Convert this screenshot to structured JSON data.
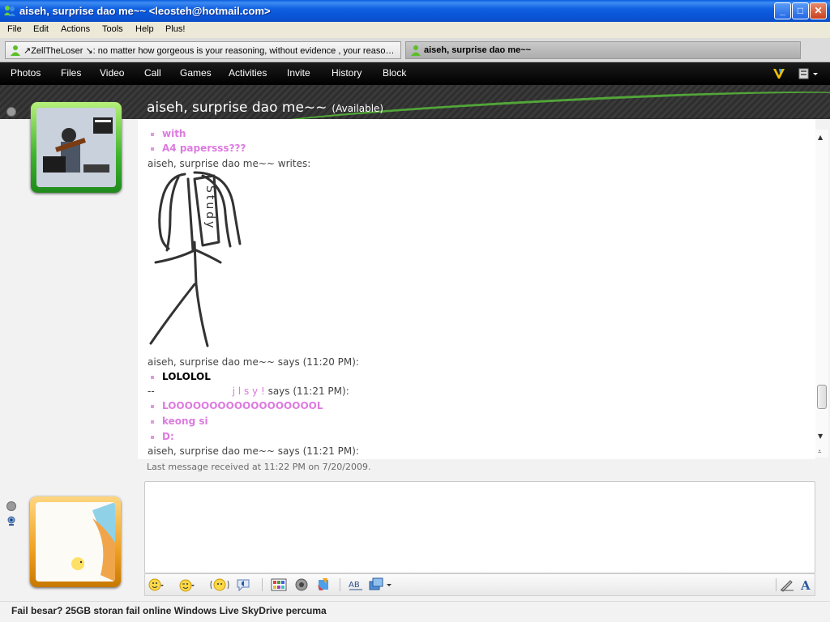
{
  "window": {
    "title": "aiseh, surprise dao me~~ <leosteh@hotmail.com>",
    "controls": {
      "minimize": "_",
      "maximize": "□",
      "close": "✕"
    }
  },
  "menu": [
    "File",
    "Edit",
    "Actions",
    "Tools",
    "Help",
    "Plus!"
  ],
  "tabs": [
    {
      "label": "↗ZellTheLoser ↘: no matter how gorgeous is your reasoning, without evidence , your reasor…",
      "active": false
    },
    {
      "label": "aiseh, surprise dao me~~",
      "active": true
    }
  ],
  "toolbar": [
    "Photos",
    "Files",
    "Video",
    "Call",
    "Games",
    "Activities",
    "Invite",
    "History",
    "Block"
  ],
  "header": {
    "contact_name": "aiseh, surprise dao me~~",
    "status": "(Available)"
  },
  "conversation": {
    "bullet_messages_top": [
      "with",
      "A4 papersss???"
    ],
    "writes_line": "aiseh, surprise dao me~~ writes:",
    "ink_text": "Study",
    "says_1": "aiseh, surprise dao me~~ says (11:20 PM):",
    "msg_black": "LOLOLOL",
    "says_2_prefix": "--",
    "says_2_name": "j l s y !",
    "says_2_suffix": " says (11:21 PM):",
    "bullet_messages_bottom": [
      "LOOOOOOOOOOOOOOOOOOL",
      "keong si",
      "D:"
    ],
    "says_3": "aiseh, surprise dao me~~ says (11:21 PM):"
  },
  "last_received": "Last message received at 11:22 PM on 7/20/2009.",
  "footer": "Fail besar? 25GB storan fail online Windows Live SkyDrive percuma",
  "colors": {
    "title_blue": "#0b55d8",
    "pink_message": "#dd7be0",
    "online_green": "#3db22c",
    "my_frame_orange": "#f0a020"
  }
}
